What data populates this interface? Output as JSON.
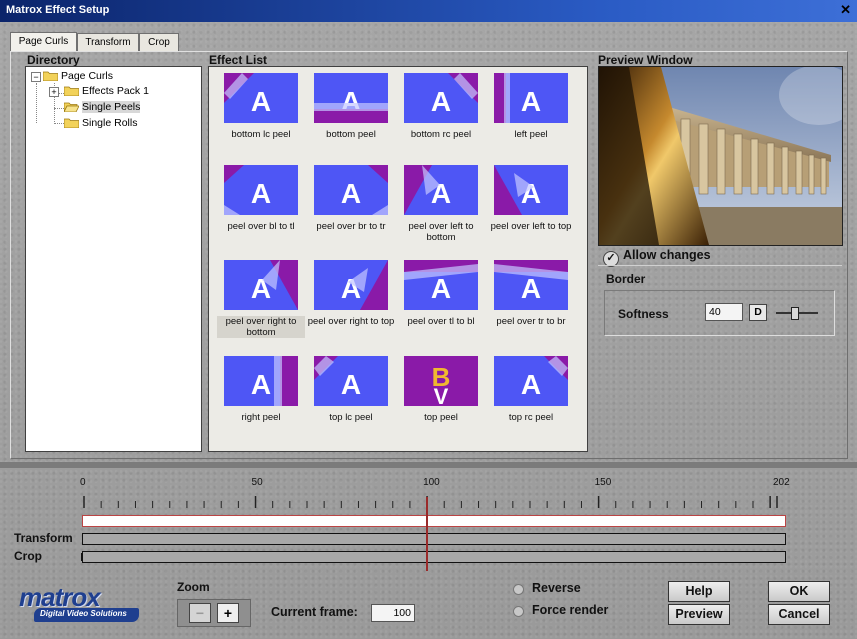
{
  "window": {
    "title": "Matrox Effect Setup",
    "close_glyph": "✕"
  },
  "tabs": [
    {
      "label": "Page Curls",
      "active": true
    },
    {
      "label": "Transform",
      "active": false
    },
    {
      "label": "Crop",
      "active": false
    }
  ],
  "directory": {
    "title": "Directory",
    "items": [
      {
        "label": "Page Curls",
        "expander": "−"
      },
      {
        "label": "Effects Pack 1",
        "expander": "+"
      },
      {
        "label": "Single Peels",
        "expander": "",
        "selected": true
      },
      {
        "label": "Single Rolls",
        "expander": ""
      }
    ]
  },
  "effect_list": {
    "title": "Effect List",
    "items": [
      {
        "label": "bottom lc peel",
        "icon": "peel-bottom-left-icon"
      },
      {
        "label": "bottom peel",
        "icon": "peel-bottom-icon"
      },
      {
        "label": "bottom rc peel",
        "icon": "peel-bottom-right-icon"
      },
      {
        "label": "left peel",
        "icon": "peel-left-icon"
      },
      {
        "label": "peel over bl to tl",
        "icon": "peel-over-bl-tl-icon"
      },
      {
        "label": "peel over br to tr",
        "icon": "peel-over-br-tr-icon"
      },
      {
        "label": "peel over left to bottom",
        "icon": "peel-over-left-bottom-icon"
      },
      {
        "label": "peel over left to top",
        "icon": "peel-over-left-top-icon"
      },
      {
        "label": "peel over right to bottom",
        "icon": "peel-over-right-bottom-icon",
        "selected": true
      },
      {
        "label": "peel over right to top",
        "icon": "peel-over-right-top-icon"
      },
      {
        "label": "peel over tl to bl",
        "icon": "peel-over-tl-bl-icon"
      },
      {
        "label": "peel over tr to br",
        "icon": "peel-over-tr-br-icon"
      },
      {
        "label": "right peel",
        "icon": "peel-right-icon"
      },
      {
        "label": "top lc peel",
        "icon": "peel-top-left-icon"
      },
      {
        "label": "top peel",
        "icon": "peel-top-icon"
      },
      {
        "label": "top rc peel",
        "icon": "peel-top-right-icon"
      }
    ]
  },
  "preview": {
    "title": "Preview Window"
  },
  "allow_changes": {
    "label": "Allow changes",
    "checked": true
  },
  "border": {
    "title": "Border",
    "softness_label": "Softness",
    "softness_value": "40",
    "default_button": "D"
  },
  "timeline": {
    "ticks": [
      {
        "v": 0,
        "label": "0"
      },
      {
        "v": 50,
        "label": "50"
      },
      {
        "v": 100,
        "label": "100"
      },
      {
        "v": 150,
        "label": "150"
      },
      {
        "v": 202,
        "label": "202"
      }
    ],
    "max": 202,
    "current": 100,
    "tracks": [
      {
        "label": ""
      },
      {
        "label": "Transform"
      },
      {
        "label": "Crop"
      }
    ]
  },
  "zoom": {
    "title": "Zoom",
    "minus": "−",
    "plus": "+"
  },
  "current_frame": {
    "label": "Current frame:",
    "value": "100"
  },
  "options": {
    "reverse": "Reverse",
    "force_render": "Force render"
  },
  "buttons": {
    "help": "Help",
    "ok": "OK",
    "preview": "Preview",
    "cancel": "Cancel"
  },
  "logo": {
    "text": "matrox",
    "tagline": "Digital Video Solutions"
  },
  "colors": {
    "thumb_blue": "#4e56f5",
    "thumb_purple": "#8a1aa8",
    "titlebar": "#0b246a",
    "playhead": "#9a2a2a",
    "selection_track": "#c0392b"
  }
}
